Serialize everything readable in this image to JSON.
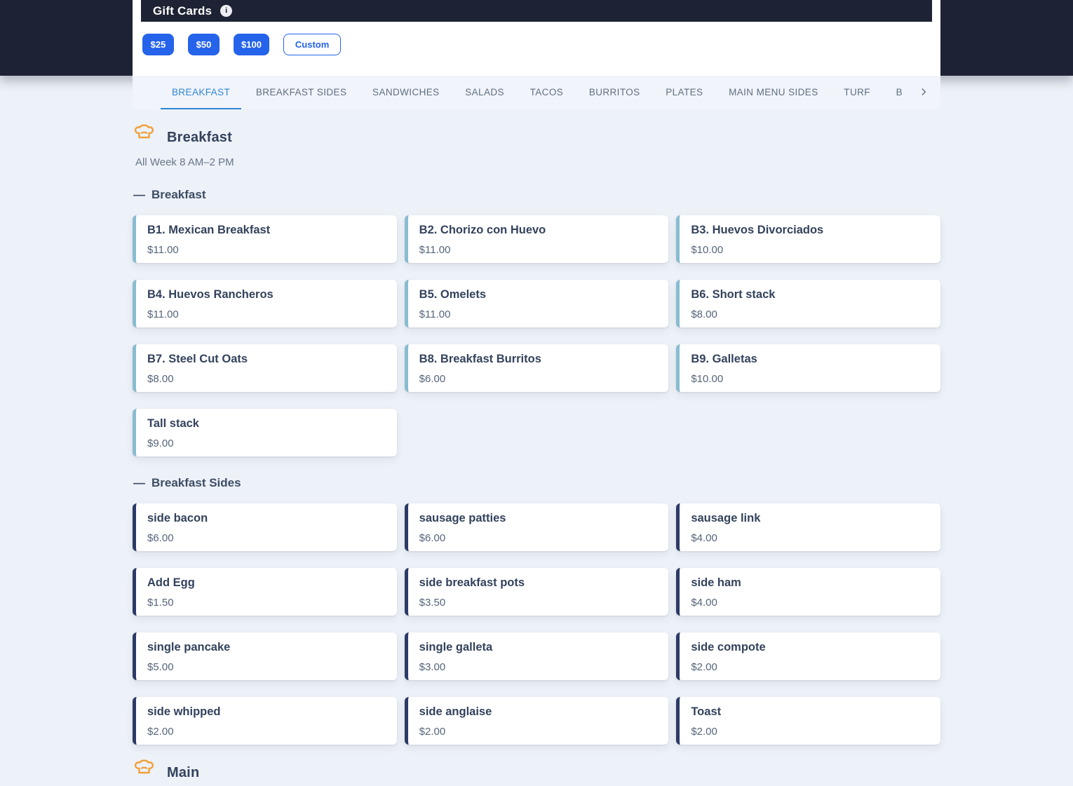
{
  "colors": {
    "hero_dark": "#1d2234",
    "page_bg": "#edf1f8",
    "primary_blue": "#2563eb",
    "active_tab_blue": "#2e86d3",
    "accent_breakfast": "#89bcd1",
    "accent_breakfast_sides": "#2c3a66",
    "chef_icon_orange": "#f0a23e"
  },
  "gift_cards": {
    "title": "Gift Cards",
    "amounts": [
      "$25",
      "$50",
      "$100"
    ],
    "custom_label": "Custom"
  },
  "tabs": {
    "items": [
      {
        "label": "BREAKFAST",
        "active": true
      },
      {
        "label": "BREAKFAST SIDES",
        "active": false
      },
      {
        "label": "SANDWICHES",
        "active": false
      },
      {
        "label": "SALADS",
        "active": false
      },
      {
        "label": "TACOS",
        "active": false
      },
      {
        "label": "BURRITOS",
        "active": false
      },
      {
        "label": "PLATES",
        "active": false
      },
      {
        "label": "MAIN MENU SIDES",
        "active": false
      },
      {
        "label": "TURF",
        "active": false
      },
      {
        "label": "B",
        "active": false
      }
    ]
  },
  "sections": [
    {
      "title": "Breakfast",
      "subtitle": "All Week 8 AM–2 PM",
      "groups": [
        {
          "name": "Breakfast",
          "accent": "#89bcd1",
          "items": [
            {
              "name": "B1. Mexican Breakfast",
              "price": "$11.00"
            },
            {
              "name": "B2. Chorizo con Huevo",
              "price": "$11.00"
            },
            {
              "name": "B3. Huevos Divorciados",
              "price": "$10.00"
            },
            {
              "name": "B4. Huevos Rancheros",
              "price": "$11.00"
            },
            {
              "name": "B5. Omelets",
              "price": "$11.00"
            },
            {
              "name": "B6. Short stack",
              "price": "$8.00"
            },
            {
              "name": "B7. Steel Cut Oats",
              "price": "$8.00"
            },
            {
              "name": "B8. Breakfast Burritos",
              "price": "$6.00"
            },
            {
              "name": "B9. Galletas",
              "price": "$10.00"
            },
            {
              "name": "Tall stack",
              "price": "$9.00"
            }
          ]
        },
        {
          "name": "Breakfast Sides",
          "accent": "#2c3a66",
          "items": [
            {
              "name": "side bacon",
              "price": "$6.00"
            },
            {
              "name": "sausage patties",
              "price": "$6.00"
            },
            {
              "name": "sausage link",
              "price": "$4.00"
            },
            {
              "name": "Add Egg",
              "price": "$1.50"
            },
            {
              "name": "side breakfast pots",
              "price": "$3.50"
            },
            {
              "name": "side ham",
              "price": "$4.00"
            },
            {
              "name": "single pancake",
              "price": "$5.00"
            },
            {
              "name": "single galleta",
              "price": "$3.00"
            },
            {
              "name": "side compote",
              "price": "$2.00"
            },
            {
              "name": "side whipped",
              "price": "$2.00"
            },
            {
              "name": "side anglaise",
              "price": "$2.00"
            },
            {
              "name": "Toast",
              "price": "$2.00"
            }
          ]
        }
      ]
    },
    {
      "title": "Main",
      "subtitle": "",
      "groups": []
    }
  ]
}
